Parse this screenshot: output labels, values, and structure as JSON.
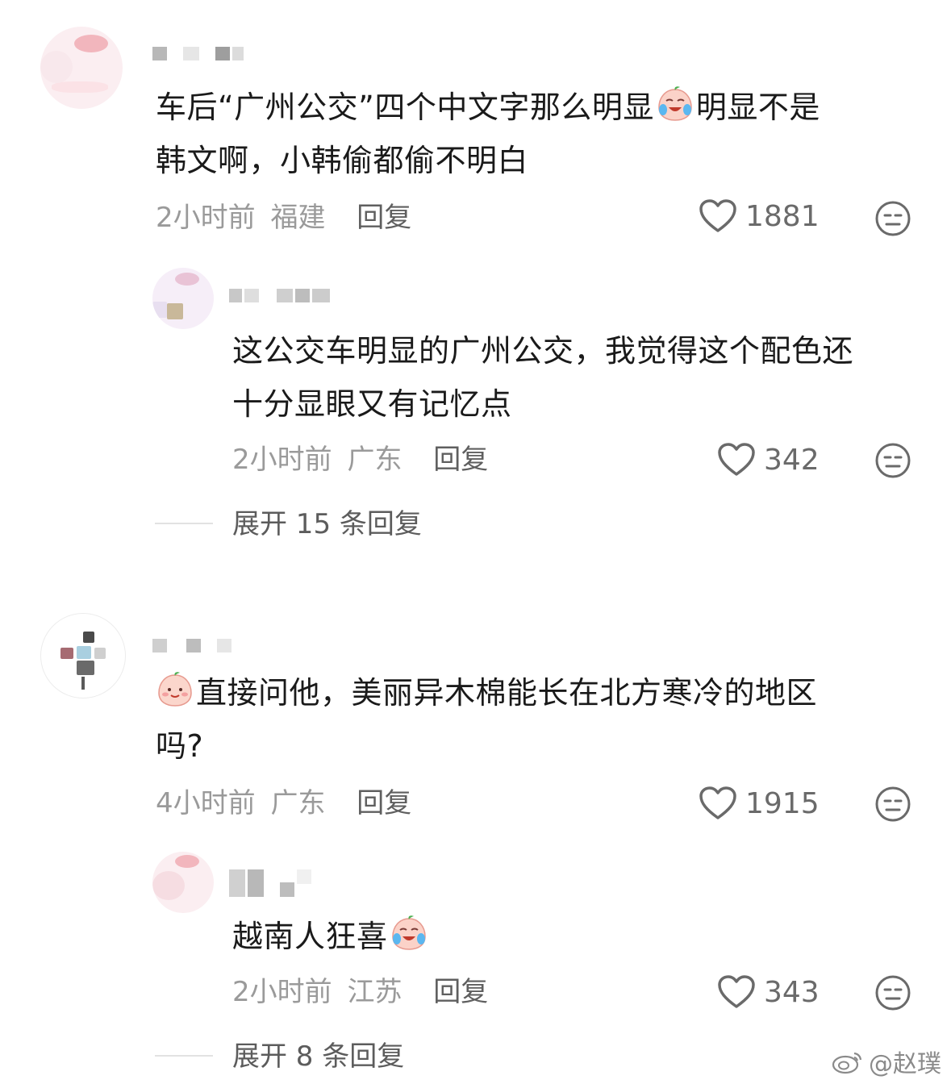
{
  "comments": [
    {
      "text_a": "车后“广州公交”四个中文字那么明显",
      "text_a_emoji": "laugh-cry-peach-emoji",
      "text_b": "明显不是",
      "text_c": "韩文啊，小韩偷都偷不明白",
      "time": "2小时前",
      "location": "福建",
      "reply_label": "回复",
      "likes": "1881",
      "reply": {
        "text_a": "这公交车明显的广州公交，我觉得这个配色还",
        "text_b": "十分显眼又有记忆点",
        "time": "2小时前",
        "location": "广东",
        "reply_label": "回复",
        "likes": "342"
      },
      "expand_label": "展开 15 条回复"
    },
    {
      "text_a_emoji": "smile-peach-emoji",
      "text_a": "直接问他，美丽异木棉能长在北方寒冷的地区",
      "text_b": "吗?",
      "time": "4小时前",
      "location": "广东",
      "reply_label": "回复",
      "likes": "1915",
      "reply": {
        "text_a": "越南人狂喜",
        "text_a_emoji": "laugh-cry-peach-emoji",
        "time": "2小时前",
        "location": "江苏",
        "reply_label": "回复",
        "likes": "343"
      },
      "expand_label": "展开 8 条回复"
    }
  ],
  "watermark": "@赵璞",
  "colors": {
    "text": "#1a1a1a",
    "meta": "#9a9a9a",
    "reply": "#5f5f5f",
    "icon": "#6a6a6a"
  }
}
